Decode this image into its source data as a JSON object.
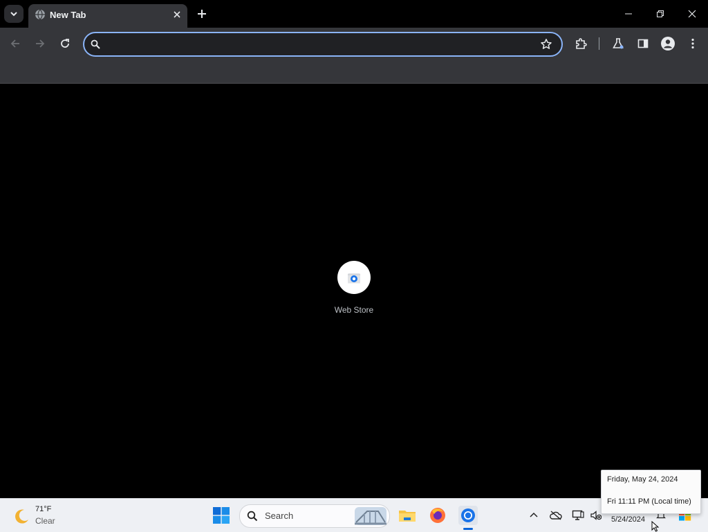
{
  "browser": {
    "tab": {
      "title": "New Tab"
    },
    "omnibox": {
      "value": "",
      "placeholder": ""
    },
    "accent_color": "#8ab4f8"
  },
  "toolbar": {
    "icons": [
      "back-arrow-icon",
      "forward-arrow-icon",
      "reload-icon",
      "search-icon",
      "star-icon",
      "extensions-puzzle-icon",
      "labs-flask-icon",
      "side-panel-icon",
      "profile-icon",
      "more-vert-icon"
    ]
  },
  "new_tab_page": {
    "shortcuts": [
      {
        "label": "Web Store",
        "icon": "chrome-web-store-icon"
      }
    ]
  },
  "taskbar": {
    "weather": {
      "temperature": "71°F",
      "condition": "Clear",
      "icon": "moon-icon"
    },
    "search": {
      "label": "Search"
    },
    "pinned_apps": [
      "file-explorer-icon",
      "firefox-icon",
      "chrome-icon"
    ],
    "tray": {
      "date": "5/24/2024"
    }
  },
  "clock_tooltip": {
    "date_line": "Friday, May 24, 2024",
    "time_line": "Fri 11:11 PM (Local time)"
  }
}
